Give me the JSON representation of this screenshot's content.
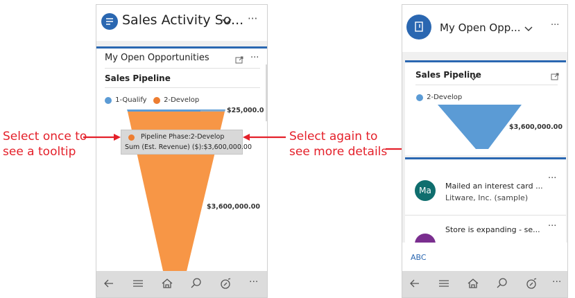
{
  "left_phone": {
    "header_title": "Sales Activity So...",
    "card_title": "My Open Opportunities",
    "chart_title": "Sales Pipeline",
    "legend": [
      {
        "label": "1-Qualify",
        "color": "#5b9bd5"
      },
      {
        "label": "2-Develop",
        "color": "#ed7d31"
      }
    ],
    "value_top": "$25,000.0",
    "value_main": "$3,600,000.00",
    "tooltip_line1": "Pipeline Phase:2-Develop",
    "tooltip_line2": "Sum (Est. Revenue) ($):$3,600,000.00",
    "more": "···"
  },
  "right_phone": {
    "header_title": "My Open Opp...",
    "chart_title": "Sales Pipeline",
    "legend": [
      {
        "label": "2-Develop",
        "color": "#5b9bd5"
      }
    ],
    "value_main": "$3,600,000.00",
    "list": [
      {
        "avatar": "Ma",
        "avatar_color": "#0f6e6e",
        "title": "Mailed an interest card ...",
        "subtitle": "Litware, Inc. (sample)"
      },
      {
        "avatar": "",
        "avatar_color": "#7a2e8f",
        "title": "Store is expanding - se...",
        "subtitle": ""
      }
    ],
    "footer_link": "ABC",
    "more": "···"
  },
  "annotations": {
    "left_line1": "Select once to",
    "left_line2": "see a tooltip",
    "mid_line1": "Select again to",
    "mid_line2": "see more details"
  },
  "colors": {
    "accent": "#2a67b1",
    "annotation": "#e4202a",
    "funnel_orange": "#f79646",
    "funnel_blue": "#5b9bd5"
  },
  "icons": [
    "back-arrow-icon",
    "menu-icon",
    "home-icon",
    "search-icon",
    "compass-icon",
    "more-icon"
  ]
}
